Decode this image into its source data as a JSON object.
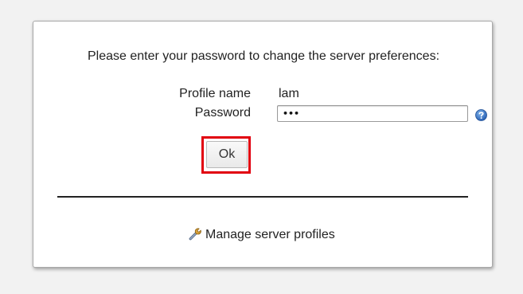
{
  "login_panel": {
    "prompt_text": "Please enter your password to change the server preferences:",
    "profile_name_label": "Profile name",
    "profile_name_value": "lam",
    "password_label": "Password",
    "password_value": "abc",
    "ok_label": "Ok",
    "manage_profiles_label": "Manage server profiles"
  },
  "icons": {
    "help": "help-icon",
    "manage": "wrench-icon"
  },
  "colors": {
    "highlight_border": "#e1000f",
    "help_icon_blue": "#3b78c9"
  }
}
